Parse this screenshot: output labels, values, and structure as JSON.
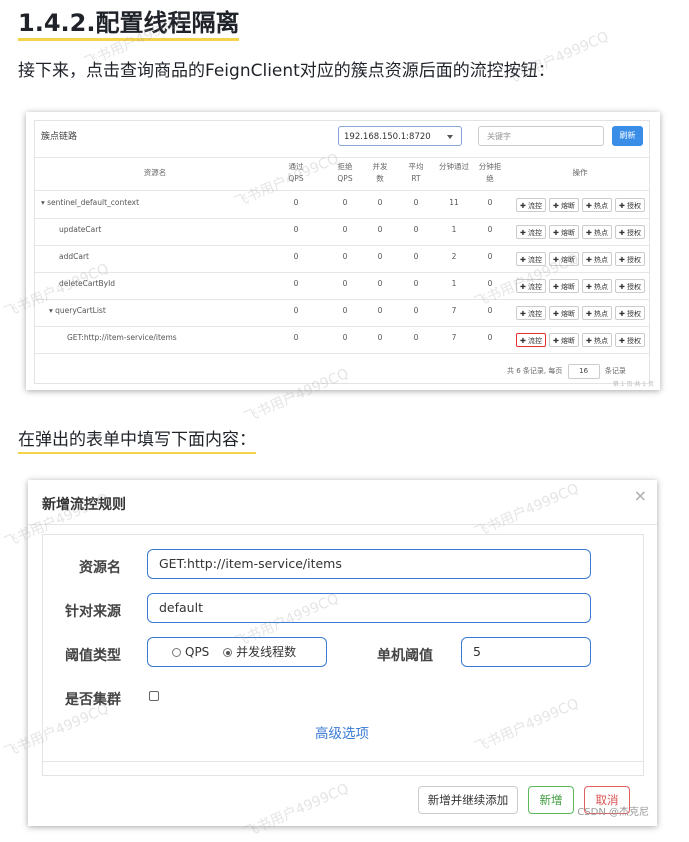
{
  "heading": "1.4.2.配置线程隔离",
  "paragraph1": "接下来，点击查询商品的FeignClient对应的簇点资源后面的流控按钮：",
  "paragraph2": "在弹出的表单中填写下面内容：",
  "watermark": "飞书用户4999CQ",
  "table_screen": {
    "title": "簇点链路",
    "machine_select": "192.168.150.1:8720",
    "search_placeholder": "关键字",
    "refresh_button": "刷新",
    "columns": [
      "资源名",
      "通过QPS",
      "拒绝QPS",
      "并发数",
      "平均RT",
      "分钟通过",
      "分钟拒绝",
      "操作"
    ],
    "rows": [
      {
        "name": "▾ sentinel_default_context",
        "pass_qps": "0",
        "block_qps": "0",
        "threads": "0",
        "avg_rt": "0",
        "min_pass": "11",
        "min_block": "0"
      },
      {
        "name": "updateCart",
        "pass_qps": "0",
        "block_qps": "0",
        "threads": "0",
        "avg_rt": "0",
        "min_pass": "1",
        "min_block": "0"
      },
      {
        "name": "addCart",
        "pass_qps": "0",
        "block_qps": "0",
        "threads": "0",
        "avg_rt": "0",
        "min_pass": "2",
        "min_block": "0"
      },
      {
        "name": "deleteCartById",
        "pass_qps": "0",
        "block_qps": "0",
        "threads": "0",
        "avg_rt": "0",
        "min_pass": "1",
        "min_block": "0"
      },
      {
        "name": "▾ queryCartList",
        "pass_qps": "0",
        "block_qps": "0",
        "threads": "0",
        "avg_rt": "0",
        "min_pass": "7",
        "min_block": "0"
      },
      {
        "name": "GET:http://item-service/items",
        "pass_qps": "0",
        "block_qps": "0",
        "threads": "0",
        "avg_rt": "0",
        "min_pass": "7",
        "min_block": "0"
      }
    ],
    "actions": [
      "✚ 流控",
      "✚ 熔断",
      "✚ 热点",
      "✚ 授权"
    ],
    "pager_prefix": "共 6 条记录, 每页",
    "page_size": "16",
    "pager_suffix": "条记录",
    "footer": "第 1 页 共 1 页"
  },
  "dialog_screen": {
    "title": "新增流控规则",
    "close": "×",
    "resource_label": "资源名",
    "resource_value": "GET:http://item-service/items",
    "origin_label": "针对来源",
    "origin_value": "default",
    "grade_label": "阈值类型",
    "grade_options": [
      "QPS",
      "并发线程数"
    ],
    "grade_selected": "并发线程数",
    "threshold_label": "单机阈值",
    "threshold_value": "5",
    "cluster_label": "是否集群",
    "advanced_link": "高级选项",
    "btn_add_continue": "新增并继续添加",
    "btn_add": "新增",
    "btn_cancel": "取消",
    "footnote": "CSDN @杰克尼"
  }
}
